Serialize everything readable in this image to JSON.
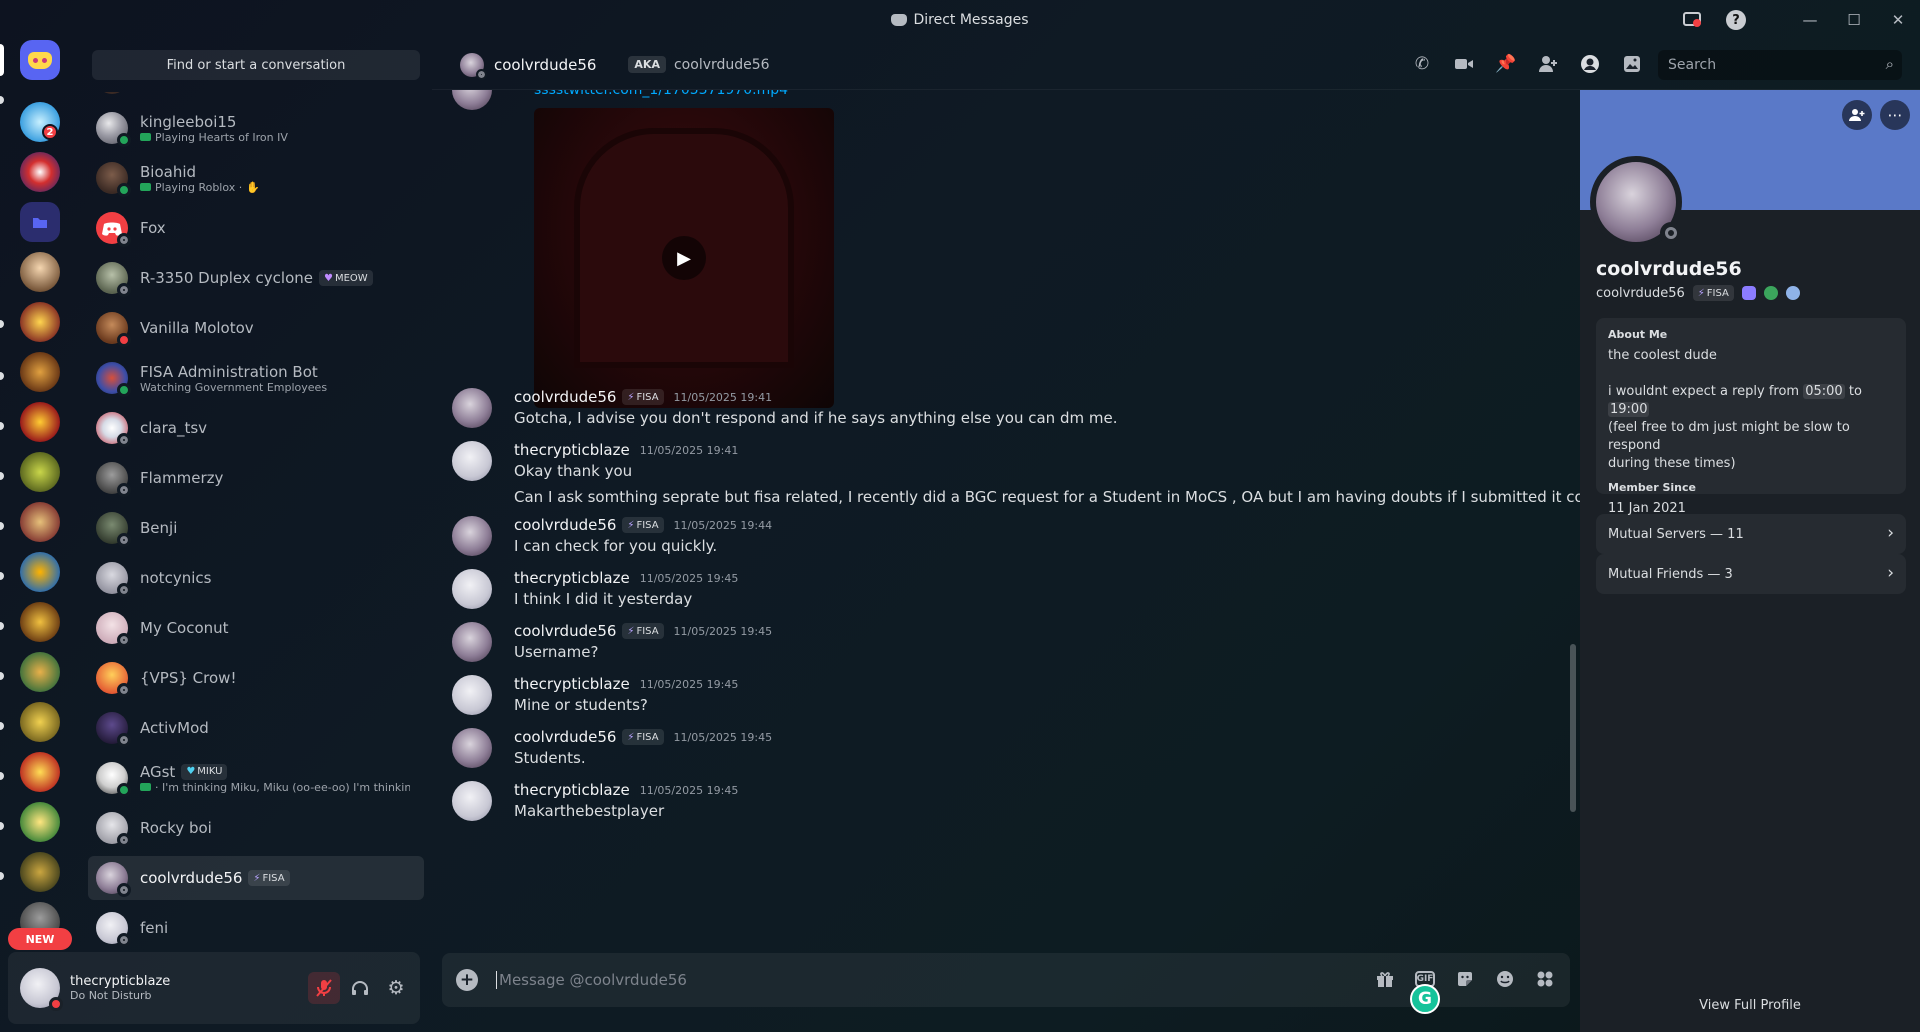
{
  "window": {
    "title": "Direct Messages"
  },
  "dm_sidebar": {
    "find_placeholder": "Find or start a conversation",
    "items": [
      {
        "name": "kingleeboi15",
        "sub": "Playing Hearts of Iron IV",
        "status": "online"
      },
      {
        "name": "Bioahid",
        "sub": "Playing Roblox ·",
        "status": "online"
      },
      {
        "name": "Fox",
        "sub": "",
        "status": "offline"
      },
      {
        "name": "R-3350 Duplex cyclone",
        "tag": "MEOW",
        "sub": "",
        "status": "offline"
      },
      {
        "name": "Vanilla Molotov",
        "sub": "",
        "status": "dnd"
      },
      {
        "name": "FISA Administration Bot",
        "sub": "Watching Government Employees",
        "status": "online"
      },
      {
        "name": "clara_tsv",
        "sub": "",
        "status": "offline"
      },
      {
        "name": "Flammerzy",
        "sub": "",
        "status": "offline"
      },
      {
        "name": "Benji",
        "sub": "",
        "status": "offline"
      },
      {
        "name": "notcynics",
        "sub": "",
        "status": "offline"
      },
      {
        "name": "My Coconut",
        "sub": "",
        "status": "offline"
      },
      {
        "name": "{VPS} Crow!",
        "sub": "",
        "status": "offline"
      },
      {
        "name": "ActivMod",
        "sub": "",
        "status": "offline"
      },
      {
        "name": "AGst",
        "tag": "MIKU",
        "sub": "· I'm thinking Miku, Miku (oo-ee-oo) I'm thinkin...",
        "status": "online"
      },
      {
        "name": "Rocky boi",
        "sub": "",
        "status": "offline"
      },
      {
        "name": "coolvrdude56",
        "tag": "FISA",
        "sub": "",
        "status": "offline",
        "active": true
      },
      {
        "name": "feni",
        "sub": "",
        "status": "offline"
      }
    ]
  },
  "rail": {
    "new_label": "NEW",
    "badge_count": "2"
  },
  "user_panel": {
    "username": "thecrypticblaze",
    "status": "Do Not Disturb"
  },
  "header": {
    "name": "coolvrdude56",
    "aka_label": "AKA",
    "aka_name": "coolvrdude56",
    "search_placeholder": "Search"
  },
  "chat": {
    "link_fragment": "sssstwitter.com_1/1705371970.mp4",
    "messages": [
      {
        "author": "coolvrdude56",
        "tag": "FISA",
        "time": "11/05/2025 19:41",
        "lines": [
          "Gotcha, I advise you don't respond and if he says anything else you can dm me."
        ]
      },
      {
        "author": "thecrypticblaze",
        "time": "11/05/2025 19:41",
        "lines": [
          "Okay thank you",
          "Can I ask somthing seprate but fisa related, I recently did a BGC request for a Student in MoCS , OA but I am having doubts if I submitted it correctly."
        ]
      },
      {
        "author": "coolvrdude56",
        "tag": "FISA",
        "time": "11/05/2025 19:44",
        "lines": [
          "I can check for you quickly."
        ]
      },
      {
        "author": "thecrypticblaze",
        "time": "11/05/2025 19:45",
        "lines": [
          "I think I did it yesterday"
        ]
      },
      {
        "author": "coolvrdude56",
        "tag": "FISA",
        "time": "11/05/2025 19:45",
        "lines": [
          "Username?"
        ]
      },
      {
        "author": "thecrypticblaze",
        "time": "11/05/2025 19:45",
        "lines": [
          "Mine or students?"
        ]
      },
      {
        "author": "coolvrdude56",
        "tag": "FISA",
        "time": "11/05/2025 19:45",
        "lines": [
          "Students."
        ]
      },
      {
        "author": "thecrypticblaze",
        "time": "11/05/2025 19:45",
        "lines": [
          "Makarthebestplayer"
        ]
      }
    ],
    "input_placeholder": "Message @coolvrdude56"
  },
  "profile": {
    "display_name": "coolvrdude56",
    "username": "coolvrdude56",
    "tag": "FISA",
    "about_label": "About Me",
    "about_line1": "the coolest dude",
    "about_pre": "i wouldnt expect a reply from",
    "time_from": "05:00",
    "about_to": "to",
    "time_to": "19:00",
    "about_line3": "(feel free to dm just might be slow to respond",
    "about_line4": "during these times)",
    "member_since_label": "Member Since",
    "member_since": "11 Jan 2021",
    "mutual_servers": "Mutual Servers — 11",
    "mutual_friends": "Mutual Friends — 3",
    "view_full": "View Full Profile"
  }
}
